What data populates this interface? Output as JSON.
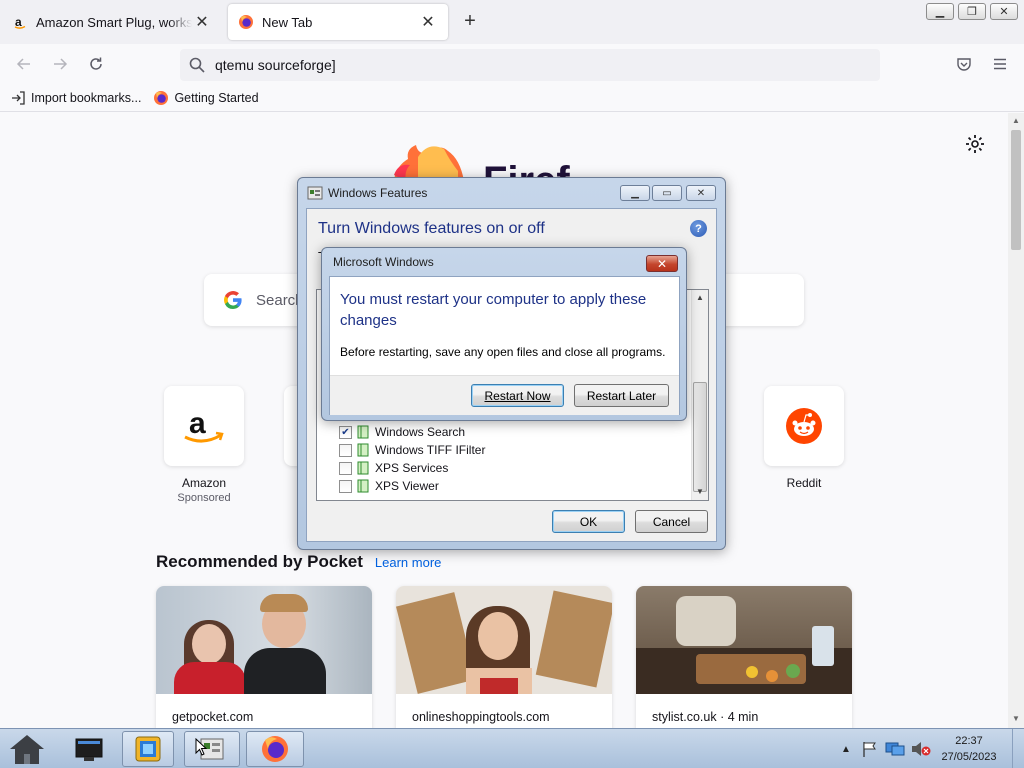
{
  "browser": {
    "tabs": [
      {
        "title": "Amazon Smart Plug, works with",
        "favicon": "amazon-icon",
        "active": false
      },
      {
        "title": "New Tab",
        "favicon": "firefox-icon",
        "active": true
      }
    ],
    "url_text": "qtemu sourceforge]",
    "bookmarks": [
      {
        "label": "Import bookmarks...",
        "icon": "import-icon"
      },
      {
        "label": "Getting Started",
        "icon": "firefox-icon"
      }
    ]
  },
  "newtab": {
    "brand": "Firef",
    "search_placeholder": "Search",
    "shortcuts": [
      {
        "label": "Amazon",
        "sub": "Sponsored",
        "icon": "amazon-icon"
      },
      {
        "label": "Reddit",
        "sub": "",
        "icon": "reddit-icon"
      }
    ],
    "pocket": {
      "heading": "Recommended by Pocket",
      "learn_more": "Learn more",
      "cards": [
        {
          "source": "getpocket.com"
        },
        {
          "source": "onlineshoppingtools.com"
        },
        {
          "source": "stylist.co.uk · 4 min"
        }
      ]
    }
  },
  "features_dialog": {
    "title": "Windows Features",
    "heading": "Turn Windows features on or off",
    "hidden_text_start": "T",
    "items": [
      {
        "label": "Windows Search",
        "checked": true
      },
      {
        "label": "Windows TIFF IFilter",
        "checked": false
      },
      {
        "label": "XPS Services",
        "checked": false
      },
      {
        "label": "XPS Viewer",
        "checked": false
      }
    ],
    "ok": "OK",
    "cancel": "Cancel"
  },
  "restart_dialog": {
    "title": "Microsoft Windows",
    "message": "You must restart your computer to apply these changes",
    "detail": "Before restarting, save any open files and close all programs.",
    "restart_now": "Restart Now",
    "restart_later": "Restart Later"
  },
  "taskbar": {
    "time": "22:37",
    "date": "27/05/2023"
  },
  "colors": {
    "accent_link": "#0061e0",
    "dialog_heading": "#1e3287",
    "taskbar": "#b9cbe2"
  }
}
